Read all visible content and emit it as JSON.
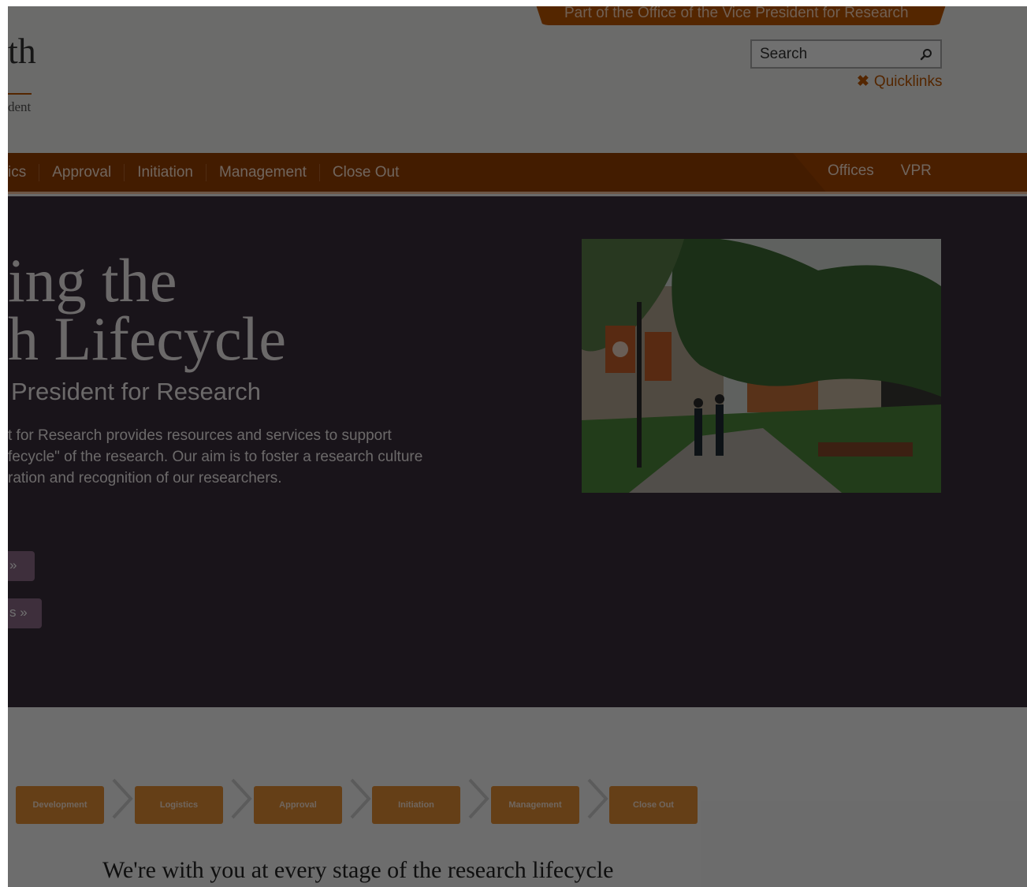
{
  "header": {
    "brand_partial": "th",
    "brand_sub_partial": "dent",
    "vpr_banner": "Part of the Office of the Vice President for Research",
    "search": {
      "placeholder": "Search"
    },
    "quicklinks": "Quicklinks"
  },
  "nav": {
    "items": [
      {
        "label": "ics"
      },
      {
        "label": "Approval"
      },
      {
        "label": "Initiation"
      },
      {
        "label": "Management"
      },
      {
        "label": "Close Out"
      }
    ],
    "right_items": [
      {
        "label": "Offices"
      },
      {
        "label": "VPR"
      }
    ]
  },
  "hero": {
    "title": "ing the\nh Lifecycle",
    "subtitle": "President for Research",
    "text": "t for Research provides resources and services to support\nfecycle\" of the research. Our aim is to foster a research culture\nration and recognition of our researchers.",
    "button1": "»",
    "button2": "s »"
  },
  "lifecycle": {
    "steps": [
      {
        "label": "Development"
      },
      {
        "label": "Logistics"
      },
      {
        "label": "Approval"
      },
      {
        "label": "Initiation"
      },
      {
        "label": "Management"
      },
      {
        "label": "Close Out"
      }
    ],
    "tagline": "We're with you at every stage of the research lifecycle"
  },
  "colors": {
    "burnt_orange": "#bf5700",
    "nav_bg": "#9a4100",
    "hero_bg": "#3a2e3c",
    "step_orange": "#e58f35"
  }
}
